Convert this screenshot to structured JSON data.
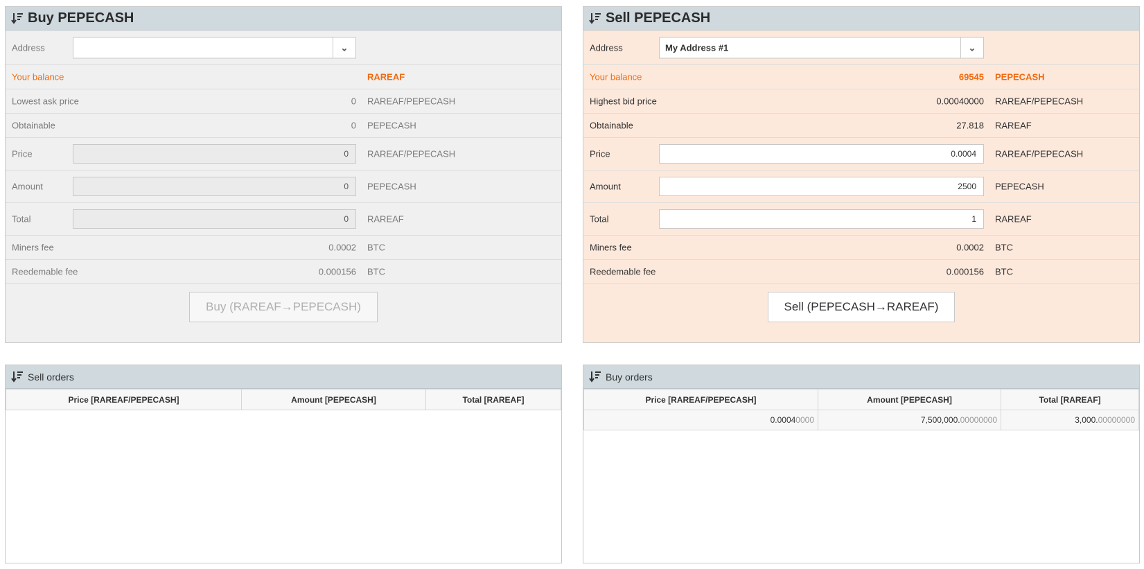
{
  "buy": {
    "title": "Buy PEPECASH",
    "address_label": "Address",
    "address_value": "",
    "balance_label": "Your balance",
    "balance_value": "",
    "balance_unit": "RAREAF",
    "lowest_ask_label": "Lowest ask price",
    "lowest_ask_value": "0",
    "lowest_ask_unit": "RAREAF/PEPECASH",
    "obtainable_label": "Obtainable",
    "obtainable_value": "0",
    "obtainable_unit": "PEPECASH",
    "price_label": "Price",
    "price_value": "0",
    "price_unit": "RAREAF/PEPECASH",
    "amount_label": "Amount",
    "amount_value": "0",
    "amount_unit": "PEPECASH",
    "total_label": "Total",
    "total_value": "0",
    "total_unit": "RAREAF",
    "miners_fee_label": "Miners fee",
    "miners_fee_value": "0.0002",
    "miners_fee_unit": "BTC",
    "redeemable_fee_label": "Reedemable fee",
    "redeemable_fee_value": "0.000156",
    "redeemable_fee_unit": "BTC",
    "button_label": "Buy (RAREAF→PEPECASH)"
  },
  "sell": {
    "title": "Sell PEPECASH",
    "address_label": "Address",
    "address_value": "My Address #1",
    "balance_label": "Your balance",
    "balance_value": "69545",
    "balance_unit": "PEPECASH",
    "highest_bid_label": "Highest bid price",
    "highest_bid_value": "0.00040000",
    "highest_bid_unit": "RAREAF/PEPECASH",
    "obtainable_label": "Obtainable",
    "obtainable_value": "27.818",
    "obtainable_unit": "RAREAF",
    "price_label": "Price",
    "price_value": "0.0004",
    "price_unit": "RAREAF/PEPECASH",
    "amount_label": "Amount",
    "amount_value": "2500",
    "amount_unit": "PEPECASH",
    "total_label": "Total",
    "total_value": "1",
    "total_unit": "RAREAF",
    "miners_fee_label": "Miners fee",
    "miners_fee_value": "0.0002",
    "miners_fee_unit": "BTC",
    "redeemable_fee_label": "Reedemable fee",
    "redeemable_fee_value": "0.000156",
    "redeemable_fee_unit": "BTC",
    "button_label": "Sell (PEPECASH→RAREAF)"
  },
  "sell_orders": {
    "title": "Sell orders",
    "columns": [
      "Price [RAREAF/PEPECASH]",
      "Amount [PEPECASH]",
      "Total [RAREAF]"
    ]
  },
  "buy_orders": {
    "title": "Buy orders",
    "columns": [
      "Price [RAREAF/PEPECASH]",
      "Amount [PEPECASH]",
      "Total [RAREAF]"
    ],
    "rows": [
      {
        "price_main": "0.0004",
        "price_faded": "0000",
        "amount_main": "7,500,000.",
        "amount_faded": "00000000",
        "total_main": "3,000.",
        "total_faded": "00000000"
      }
    ]
  },
  "colors": {
    "header_bg": "#cfd9de",
    "balance_orange": "#f06a10",
    "sell_bg": "#fde9dc"
  },
  "icons": {
    "panel_header": "sort-icon",
    "select_arrow": "chevron-down-icon"
  }
}
